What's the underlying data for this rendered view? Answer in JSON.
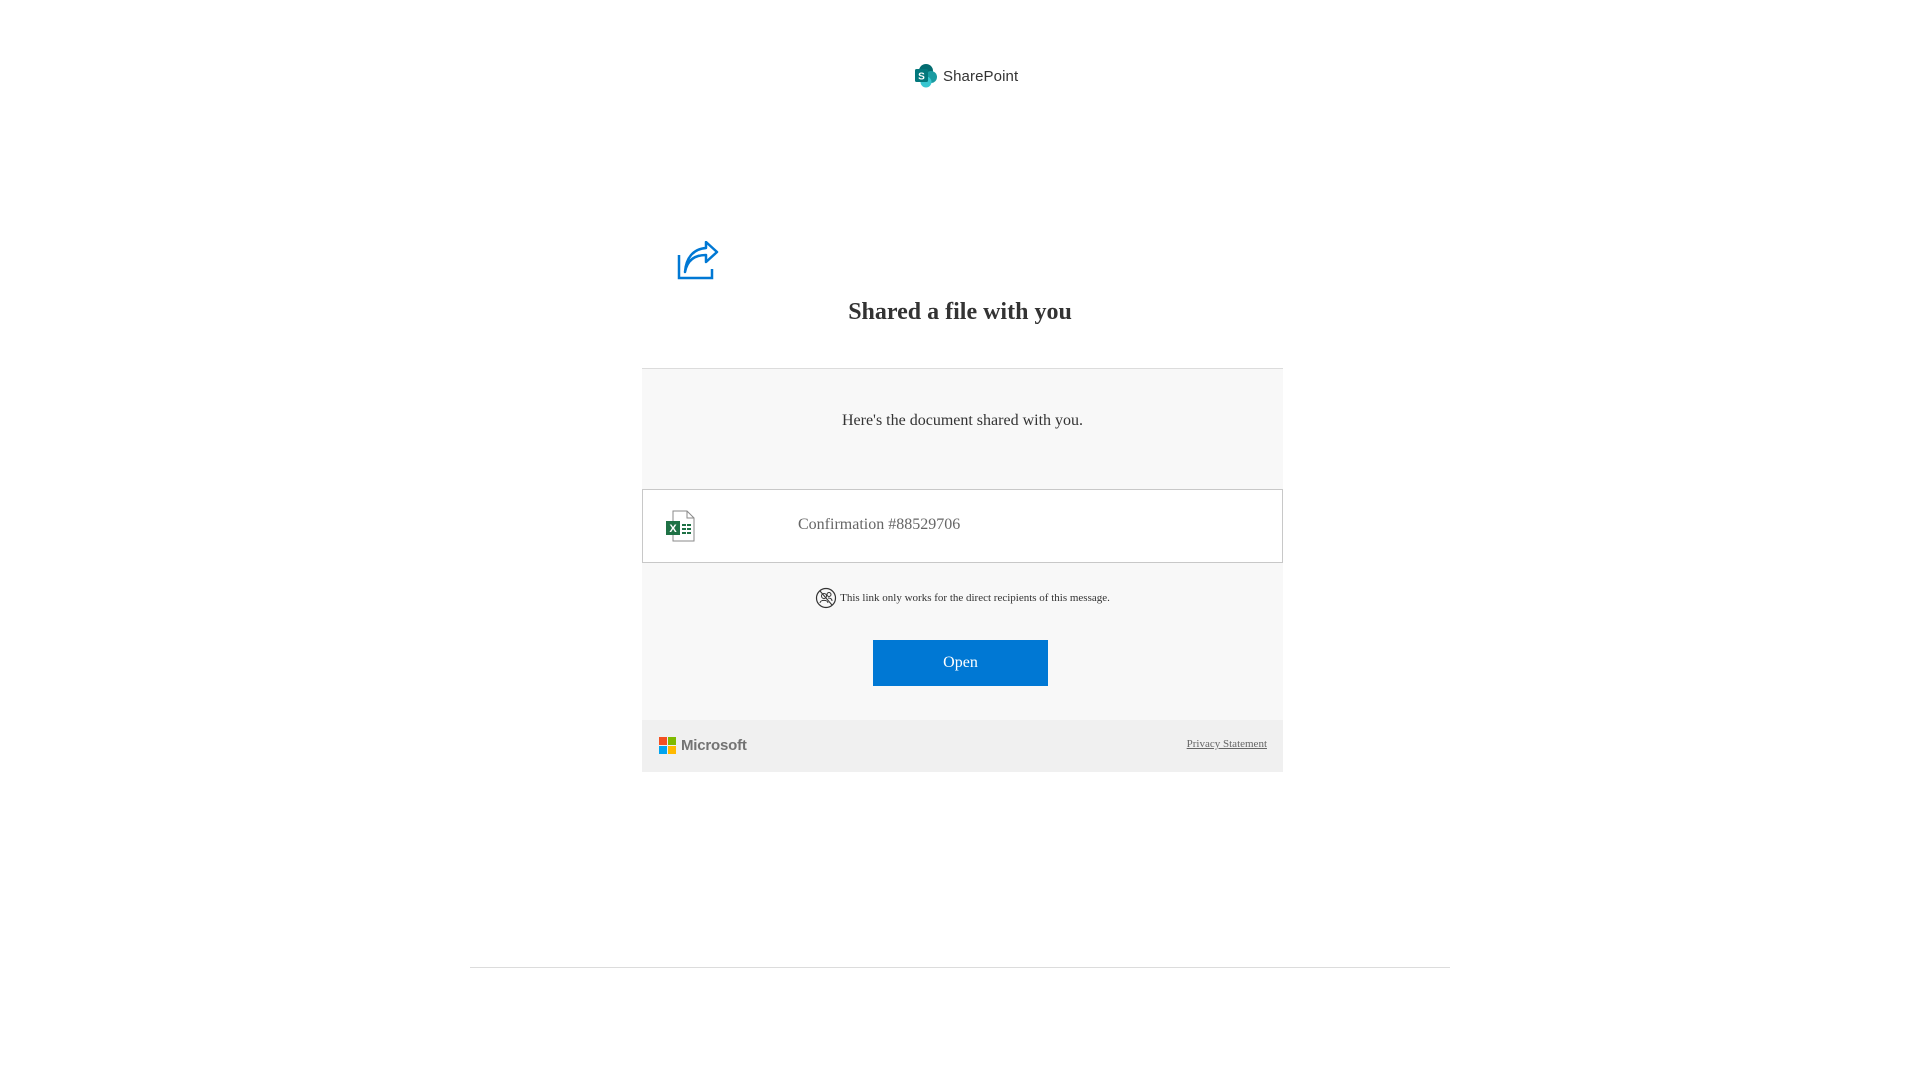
{
  "header": {
    "app_name": "SharePoint",
    "logo_icon": "sharepoint-logo-icon"
  },
  "hero": {
    "icon": "share-arrow-icon",
    "title": "Shared a file with you"
  },
  "card": {
    "message": "Here's the document shared with you.",
    "file": {
      "icon": "excel-file-icon",
      "name": "Confirmation #88529706"
    },
    "notice": {
      "icon": "restricted-people-icon",
      "text": "This link only works for the direct recipients of this message."
    },
    "open_label": "Open"
  },
  "footer": {
    "brand": "Microsoft",
    "privacy_label": "Privacy Statement"
  },
  "colors": {
    "accent": "#0078d4",
    "sharepoint_teal": "#038387",
    "excel_green": "#1e7145"
  }
}
